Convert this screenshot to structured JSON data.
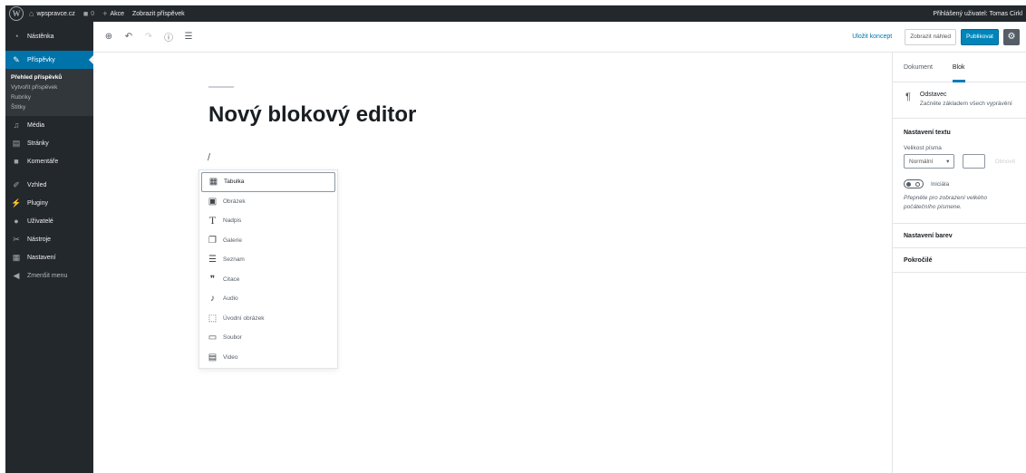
{
  "adminbar": {
    "site_name": "wpspravce.cz",
    "comments_count": "0",
    "new_label": "Akce",
    "view_post": "Zobrazit příspěvek",
    "user_greeting": "Přihlášený uživatel: Tomas Cirkl"
  },
  "sidebar": {
    "items": [
      {
        "label": "Nástěnka",
        "icon": "dashboard-icon"
      },
      {
        "label": "Příspěvky",
        "icon": "pin-icon"
      },
      {
        "label": "Média",
        "icon": "media-icon"
      },
      {
        "label": "Stránky",
        "icon": "page-icon"
      },
      {
        "label": "Komentáře",
        "icon": "comment-icon"
      },
      {
        "label": "Vzhled",
        "icon": "brush-icon"
      },
      {
        "label": "Pluginy",
        "icon": "plugin-icon"
      },
      {
        "label": "Uživatelé",
        "icon": "user-icon"
      },
      {
        "label": "Nástroje",
        "icon": "wrench-icon"
      },
      {
        "label": "Nastavení",
        "icon": "settings-icon"
      },
      {
        "label": "Zmenšit menu",
        "icon": "collapse-icon"
      }
    ],
    "submenu": [
      "Přehled příspěvků",
      "Vytvořit příspěvek",
      "Rubriky",
      "Štítky"
    ]
  },
  "toolbar": {
    "save_draft": "Uložit koncept",
    "preview": "Zobrazit náhled",
    "publish": "Publikovat"
  },
  "editor": {
    "title": "Nový blokový editor",
    "slash": "/"
  },
  "inserter": {
    "items": [
      {
        "label": "Tabulka",
        "icon": "table-icon"
      },
      {
        "label": "Obrázek",
        "icon": "image-icon"
      },
      {
        "label": "Nadpis",
        "icon": "heading-icon"
      },
      {
        "label": "Galerie",
        "icon": "gallery-icon"
      },
      {
        "label": "Seznam",
        "icon": "list-icon"
      },
      {
        "label": "Citace",
        "icon": "quote-icon"
      },
      {
        "label": "Audio",
        "icon": "audio-icon"
      },
      {
        "label": "Úvodní obrázek",
        "icon": "cover-icon"
      },
      {
        "label": "Soubor",
        "icon": "file-icon"
      },
      {
        "label": "Video",
        "icon": "video-icon"
      }
    ]
  },
  "rsidebar": {
    "tabs": [
      "Dokument",
      "Blok"
    ],
    "block_name": "Odstavec",
    "block_desc": "Začněte základem všech vyprávění",
    "text_settings": "Nastavení textu",
    "font_size_label": "Velikost písma",
    "font_size_value": "Normální",
    "reset": "Obnovit",
    "dropcap_label": "Iniciála",
    "dropcap_help": "Přepněte pro zobrazení velkého počátečního písmene.",
    "color_settings": "Nastavení barev",
    "advanced": "Pokročilé"
  },
  "colors": {
    "accent": "#0073aa",
    "adminbar": "#23282d",
    "publish": "#0085ba"
  }
}
